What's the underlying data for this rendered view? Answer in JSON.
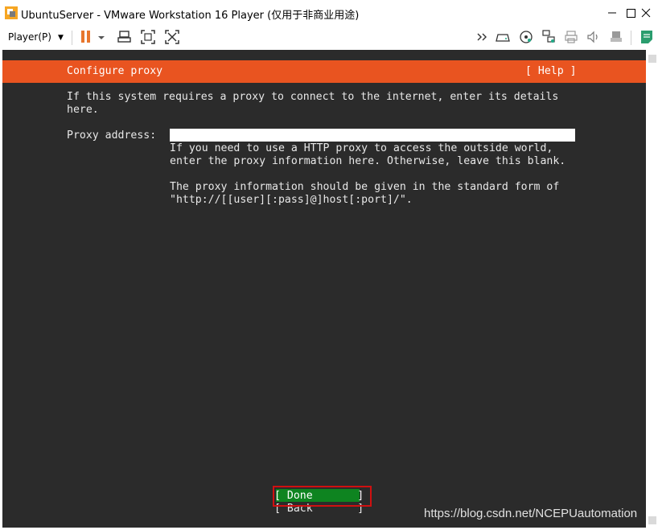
{
  "window": {
    "title": "UbuntuServer - VMware Workstation 16 Player (仅用于非商业用途)",
    "minimize_icon": "minimize-icon",
    "maximize_icon": "maximize-icon",
    "close_icon": "close-icon"
  },
  "toolbar": {
    "player_menu_label": "Player(P)",
    "icons": [
      "pause-icon",
      "send-ctrl-alt-del-icon",
      "fullscreen-icon",
      "unity-icon",
      "more-icon",
      "hdd-icon",
      "cd-icon",
      "network-icon",
      "printer-icon",
      "sound-icon",
      "usb-icon",
      "notes-icon"
    ]
  },
  "installer": {
    "header_title": "Configure proxy",
    "help_label": "[ Help ]",
    "intro_line1": "If this system requires a proxy to connect to the internet, enter its details",
    "intro_line2": "here.",
    "proxy_label": "Proxy address:",
    "proxy_value": "",
    "help_text_line1": "If you need to use a HTTP proxy to access the outside world,",
    "help_text_line2": "enter the proxy information here. Otherwise, leave this blank.",
    "help_text_line3": "The proxy information should be given in the standard form of",
    "help_text_line4": "\"http://[[user][:pass]@]host[:port]/\".",
    "done_label": "[ Done       ]",
    "back_label": "[ Back       ]"
  },
  "watermark": "https://blog.csdn.net/NCEPUautomation",
  "colors": {
    "accent": "#e95420",
    "terminal_bg": "#2b2b2b",
    "done_bg": "#0e8420",
    "focus_outline": "#d01010",
    "pause_icon": "#e8762c"
  }
}
